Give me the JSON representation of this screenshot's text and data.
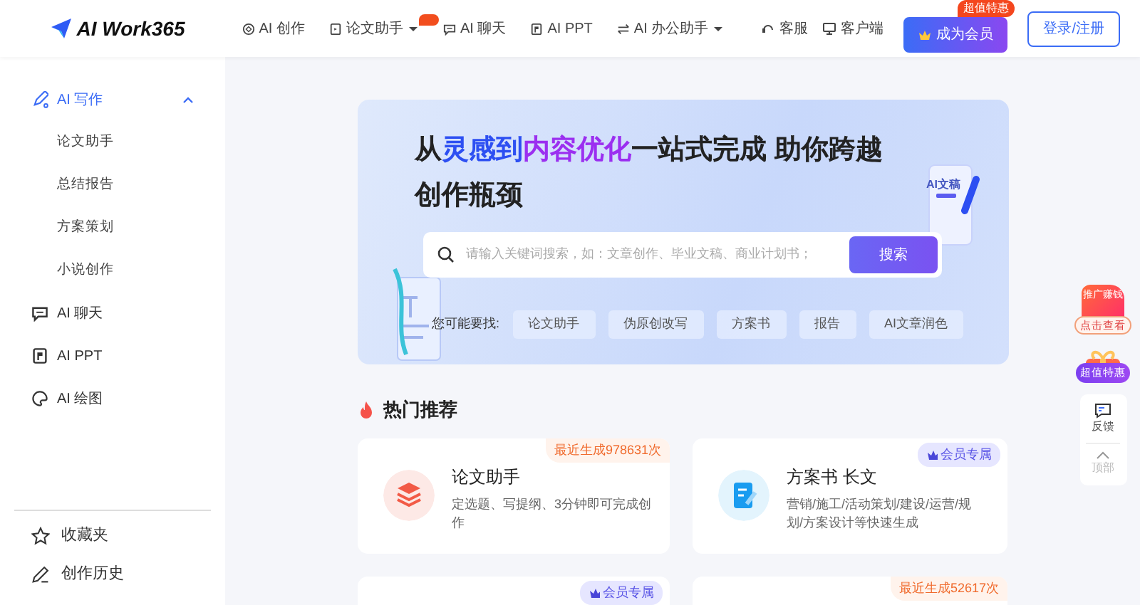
{
  "header": {
    "logo": "AI Work365",
    "nav": [
      {
        "label": "AI 创作",
        "dropdown": false,
        "hot": false
      },
      {
        "label": "论文助手",
        "dropdown": true,
        "hot": true
      },
      {
        "label": "AI 聊天",
        "dropdown": false,
        "hot": false
      },
      {
        "label": "AI PPT",
        "dropdown": false,
        "hot": false
      },
      {
        "label": "AI 办公助手",
        "dropdown": true,
        "hot": false
      }
    ],
    "service": "客服",
    "client": "客户端",
    "vip_button": "成为会员",
    "vip_badge": "超值特惠",
    "login_button": "登录/注册"
  },
  "sidebar": {
    "items": [
      {
        "label": "AI 写作",
        "selected": true,
        "expanded": true,
        "children": [
          {
            "label": "论文助手",
            "selected": false
          },
          {
            "label": "总结报告",
            "selected": false
          },
          {
            "label": "方案策划",
            "selected": false
          },
          {
            "label": "小说创作",
            "selected": false
          }
        ]
      },
      {
        "label": "AI 聊天",
        "selected": false
      },
      {
        "label": "AI PPT",
        "selected": false
      },
      {
        "label": "AI 绘图",
        "selected": false
      }
    ],
    "bottom": [
      {
        "label": "收藏夹"
      },
      {
        "label": "创作历史"
      }
    ]
  },
  "banner": {
    "title_segments": [
      {
        "text": "从",
        "color": "#222222"
      },
      {
        "text": "灵感到",
        "color": "#2d4ff2"
      },
      {
        "text": "内容优化",
        "color": "#9b2ff0"
      },
      {
        "text": "一站式完成 助你跨越创作瓶颈",
        "color": "#222222"
      }
    ],
    "search": {
      "placeholder": "请输入关键词搜索，如：文章创作、毕业文稿、商业计划书；",
      "button": "搜索"
    },
    "suggest_label": "您可能要找:",
    "suggestions": [
      "论文助手",
      "伪原创改写",
      "方案书",
      "报告",
      "AI文章润色"
    ],
    "illustration_label": "AI文稿"
  },
  "hot": {
    "title": "热门推荐",
    "cards": [
      {
        "kind": "count",
        "title": "论文助手",
        "desc": "定选题、写提纲、3分钟即可完成创作",
        "badge": "最近生成978631次"
      },
      {
        "kind": "vip",
        "title": "方案书 长文",
        "desc": "营销/施工/活动策划/建设/运营/规划/方案设计等快速生成",
        "badge": "会员专属"
      },
      {
        "kind": "vip",
        "badge": "会员专属"
      },
      {
        "kind": "count",
        "badge": "最近生成52617次"
      }
    ]
  },
  "float": {
    "promo_tag": "推广赚钱",
    "promo_button": "点击查看",
    "gift_button": "超值特惠",
    "feedback": "反馈",
    "top": "顶部"
  }
}
